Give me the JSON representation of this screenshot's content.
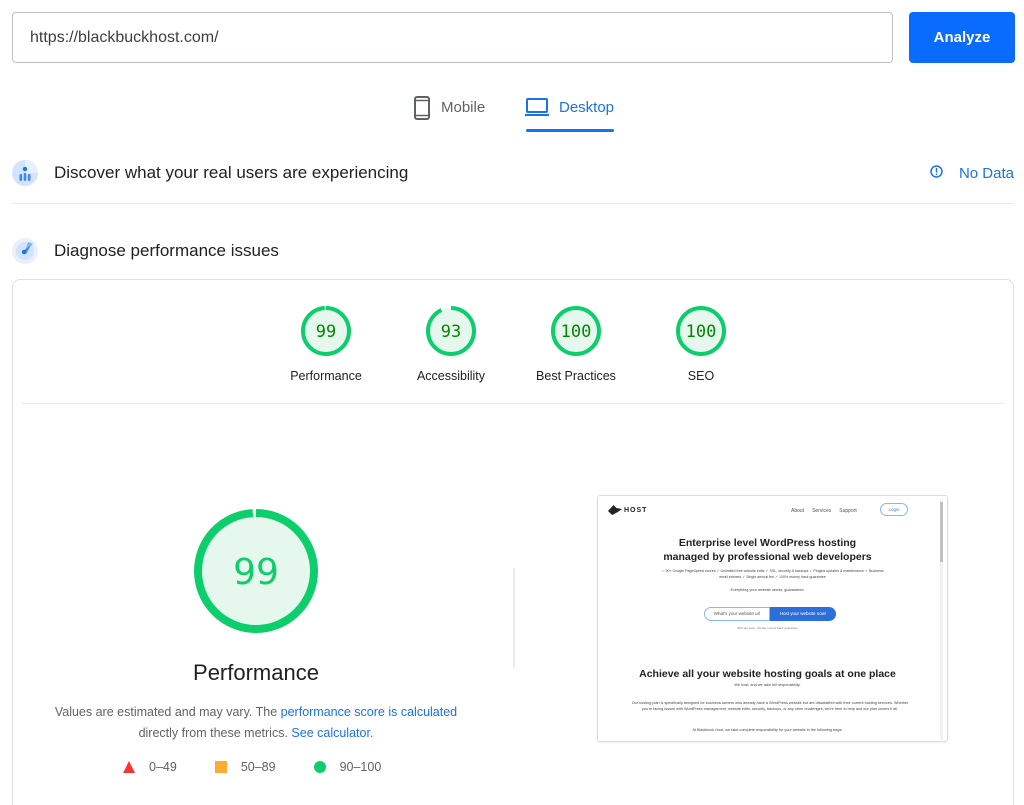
{
  "url_bar": {
    "value": "https://blackbuckhost.com/",
    "analyze_label": "Analyze"
  },
  "device_tabs": [
    {
      "label": "Mobile",
      "icon": "smartphone-icon",
      "active": false
    },
    {
      "label": "Desktop",
      "icon": "laptop-icon",
      "active": true
    }
  ],
  "sections": {
    "discover": {
      "title": "Discover what your real users are experiencing",
      "icon": "crux-users-icon",
      "status_label": "No Data",
      "status_icon": "info-icon"
    },
    "diagnose": {
      "title": "Diagnose performance issues",
      "icon": "lighthouse-radar-icon"
    }
  },
  "colors": {
    "accent": "#1a73e8",
    "analyze_button": "#0a6cff",
    "pass": "#0cce6b",
    "pass_fill": "#e6f8ee",
    "pass_text": "#008800",
    "average": "#ffaa33",
    "fail": "#ff3333"
  },
  "scores": [
    {
      "label": "Performance",
      "value": 99
    },
    {
      "label": "Accessibility",
      "value": 93
    },
    {
      "label": "Best Practices",
      "value": 100
    },
    {
      "label": "SEO",
      "value": 100
    }
  ],
  "performance": {
    "score": 99,
    "title": "Performance",
    "desc_prefix": "Values are estimated and may vary. The ",
    "desc_link1": "performance score is calculated",
    "desc_middle": " directly from these metrics. ",
    "desc_link2": "See calculator."
  },
  "legend": [
    {
      "shape": "triangle",
      "range": "0–49"
    },
    {
      "shape": "square",
      "range": "50–89"
    },
    {
      "shape": "circle",
      "range": "90–100"
    }
  ],
  "screenshot_thumb": {
    "logo": "HOST",
    "nav": [
      "About",
      "Services",
      "Support"
    ],
    "login": "Login",
    "headline_line1": "Enterprise level WordPress hosting",
    "headline_line2": "managed by professional web developers",
    "features_line1": "90+ Google PageSpeed scores ✓ Unlimited free website edits ✓ SSL, security & backups ✓ Plugins updates & maintenance ✓ Business",
    "features_line2": "email inboxes ✓ Single annual fee ✓ 100% money back guarantee",
    "tagline": "Everything your website needs, guaranteed.",
    "input_placeholder": "What's your website url",
    "cta": "Host your website now!",
    "note": "$XX per year · 30 day money back guarantee",
    "h2": "Achieve all your website hosting goals at one place",
    "h2_sub": "We host, and we take full responsibility.",
    "para": "Our hosting plan is specifically designed for business owners who already have a WordPress website but are dissatisfied with their current hosting services. Whether you're facing issues with WordPress management, website edits, security, backups, or any other challenges, we're here to help and our plan covers it all.",
    "para2": "At Blackbuck Host, we take complete responsibility for your website in the following ways:"
  }
}
